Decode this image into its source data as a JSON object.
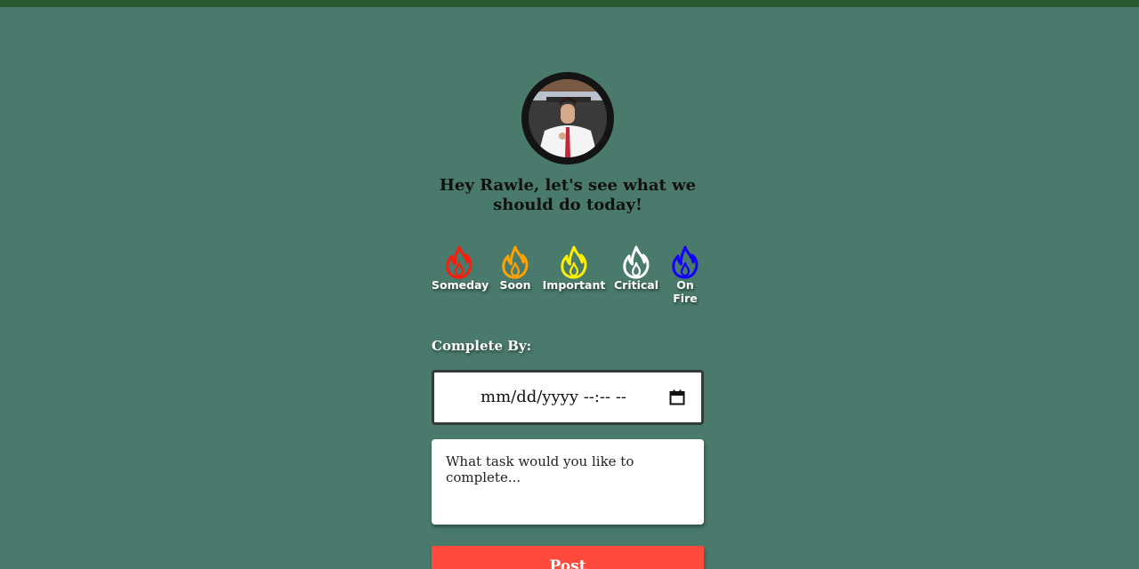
{
  "greeting": "Hey Rawle, let's see what we should do today!",
  "priorities": [
    {
      "label": "Someday",
      "color": "#ff1a0a",
      "icon": "flame-icon"
    },
    {
      "label": "Soon",
      "color": "#ffa200",
      "icon": "flame-icon"
    },
    {
      "label": "Important",
      "color": "#ffee00",
      "icon": "flame-icon"
    },
    {
      "label": "Critical",
      "color": "#ffffff",
      "icon": "flame-icon"
    },
    {
      "label": "On Fire",
      "color": "#1400ff",
      "icon": "flame-icon"
    }
  ],
  "form": {
    "complete_by_label": "Complete By:",
    "datetime_value": "mm/dd/yyyy --:-- --",
    "task_placeholder": "What task would you like to complete...",
    "post_label": "Post"
  },
  "colors": {
    "background": "#4a7a6c",
    "topbar": "#2a5a2e",
    "post_button": "#ff4a3d"
  }
}
